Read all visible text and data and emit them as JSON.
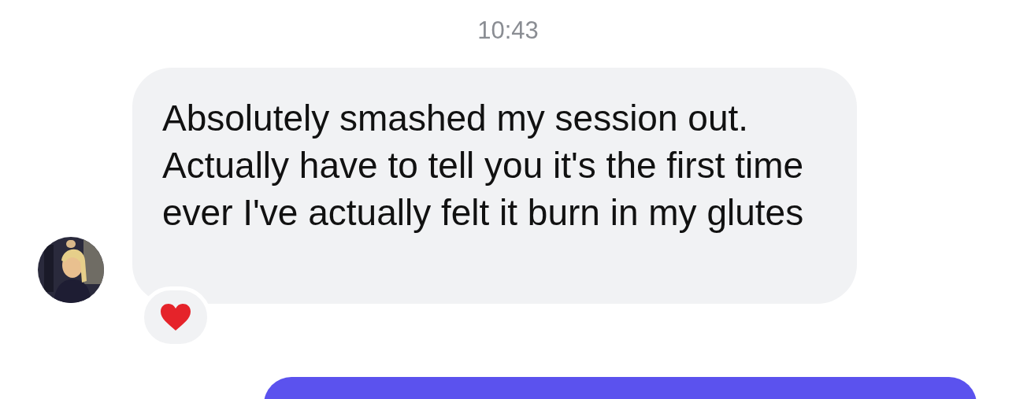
{
  "timestamp": "10:43",
  "messages": [
    {
      "kind": "incoming",
      "text": "Absolutely smashed my session out. Actually have to tell you it's the first time ever I've actually felt it burn in my glutes",
      "reaction": {
        "kind": "heart"
      }
    },
    {
      "kind": "outgoing"
    }
  ]
}
